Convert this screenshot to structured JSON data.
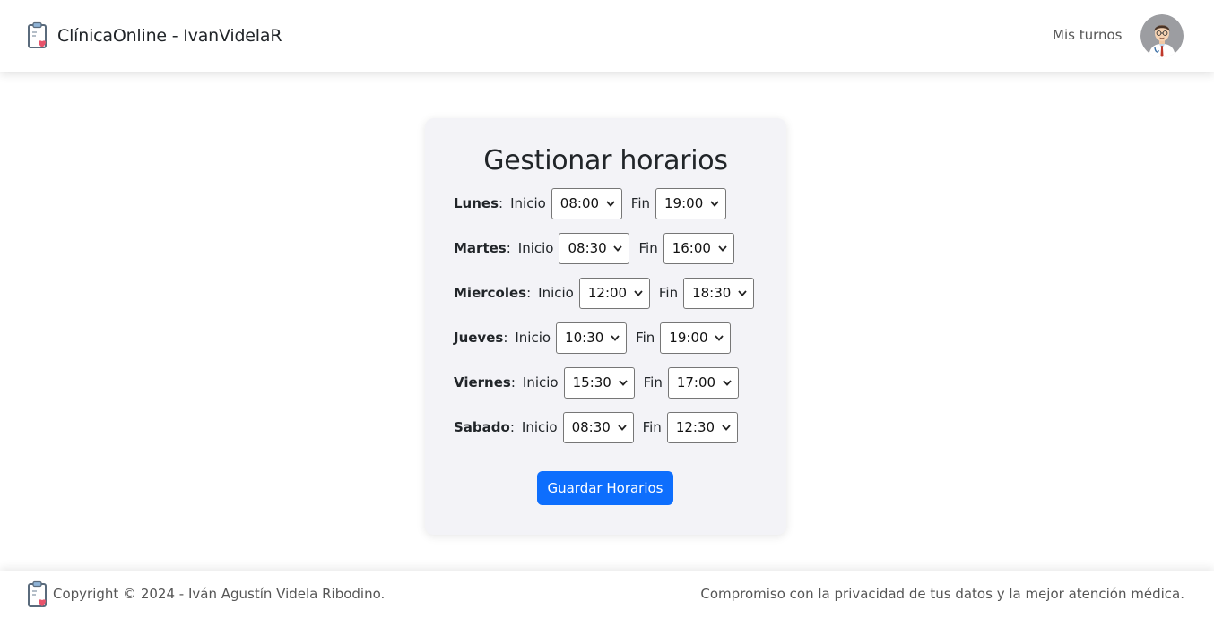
{
  "navbar": {
    "brand_text": "ClínicaOnline - IvanVidelaR",
    "link_mis_turnos": "Mis turnos"
  },
  "card": {
    "title": "Gestionar horarios",
    "inicio_label": "Inicio",
    "fin_label": "Fin",
    "days": [
      {
        "name": "Lunes",
        "inicio": "08:00",
        "fin": "19:00"
      },
      {
        "name": "Martes",
        "inicio": "08:30",
        "fin": "16:00"
      },
      {
        "name": "Miercoles",
        "inicio": "12:00",
        "fin": "18:30"
      },
      {
        "name": "Jueves",
        "inicio": "10:30",
        "fin": "19:00"
      },
      {
        "name": "Viernes",
        "inicio": "15:30",
        "fin": "17:00"
      },
      {
        "name": "Sabado",
        "inicio": "08:30",
        "fin": "12:30"
      }
    ],
    "save_button": "Guardar Horarios"
  },
  "footer": {
    "copyright": "Copyright © 2024 - Iván Agustín Videla Ribodino.",
    "tagline": "Compromiso con la privacidad de tus datos y la mejor atención médica."
  },
  "colors": {
    "primary": "#0d6efd",
    "card_bg": "#f3f3f7"
  },
  "icons": [
    "clipboard-heart-icon",
    "doctor-avatar",
    "chevron-down-icon"
  ]
}
